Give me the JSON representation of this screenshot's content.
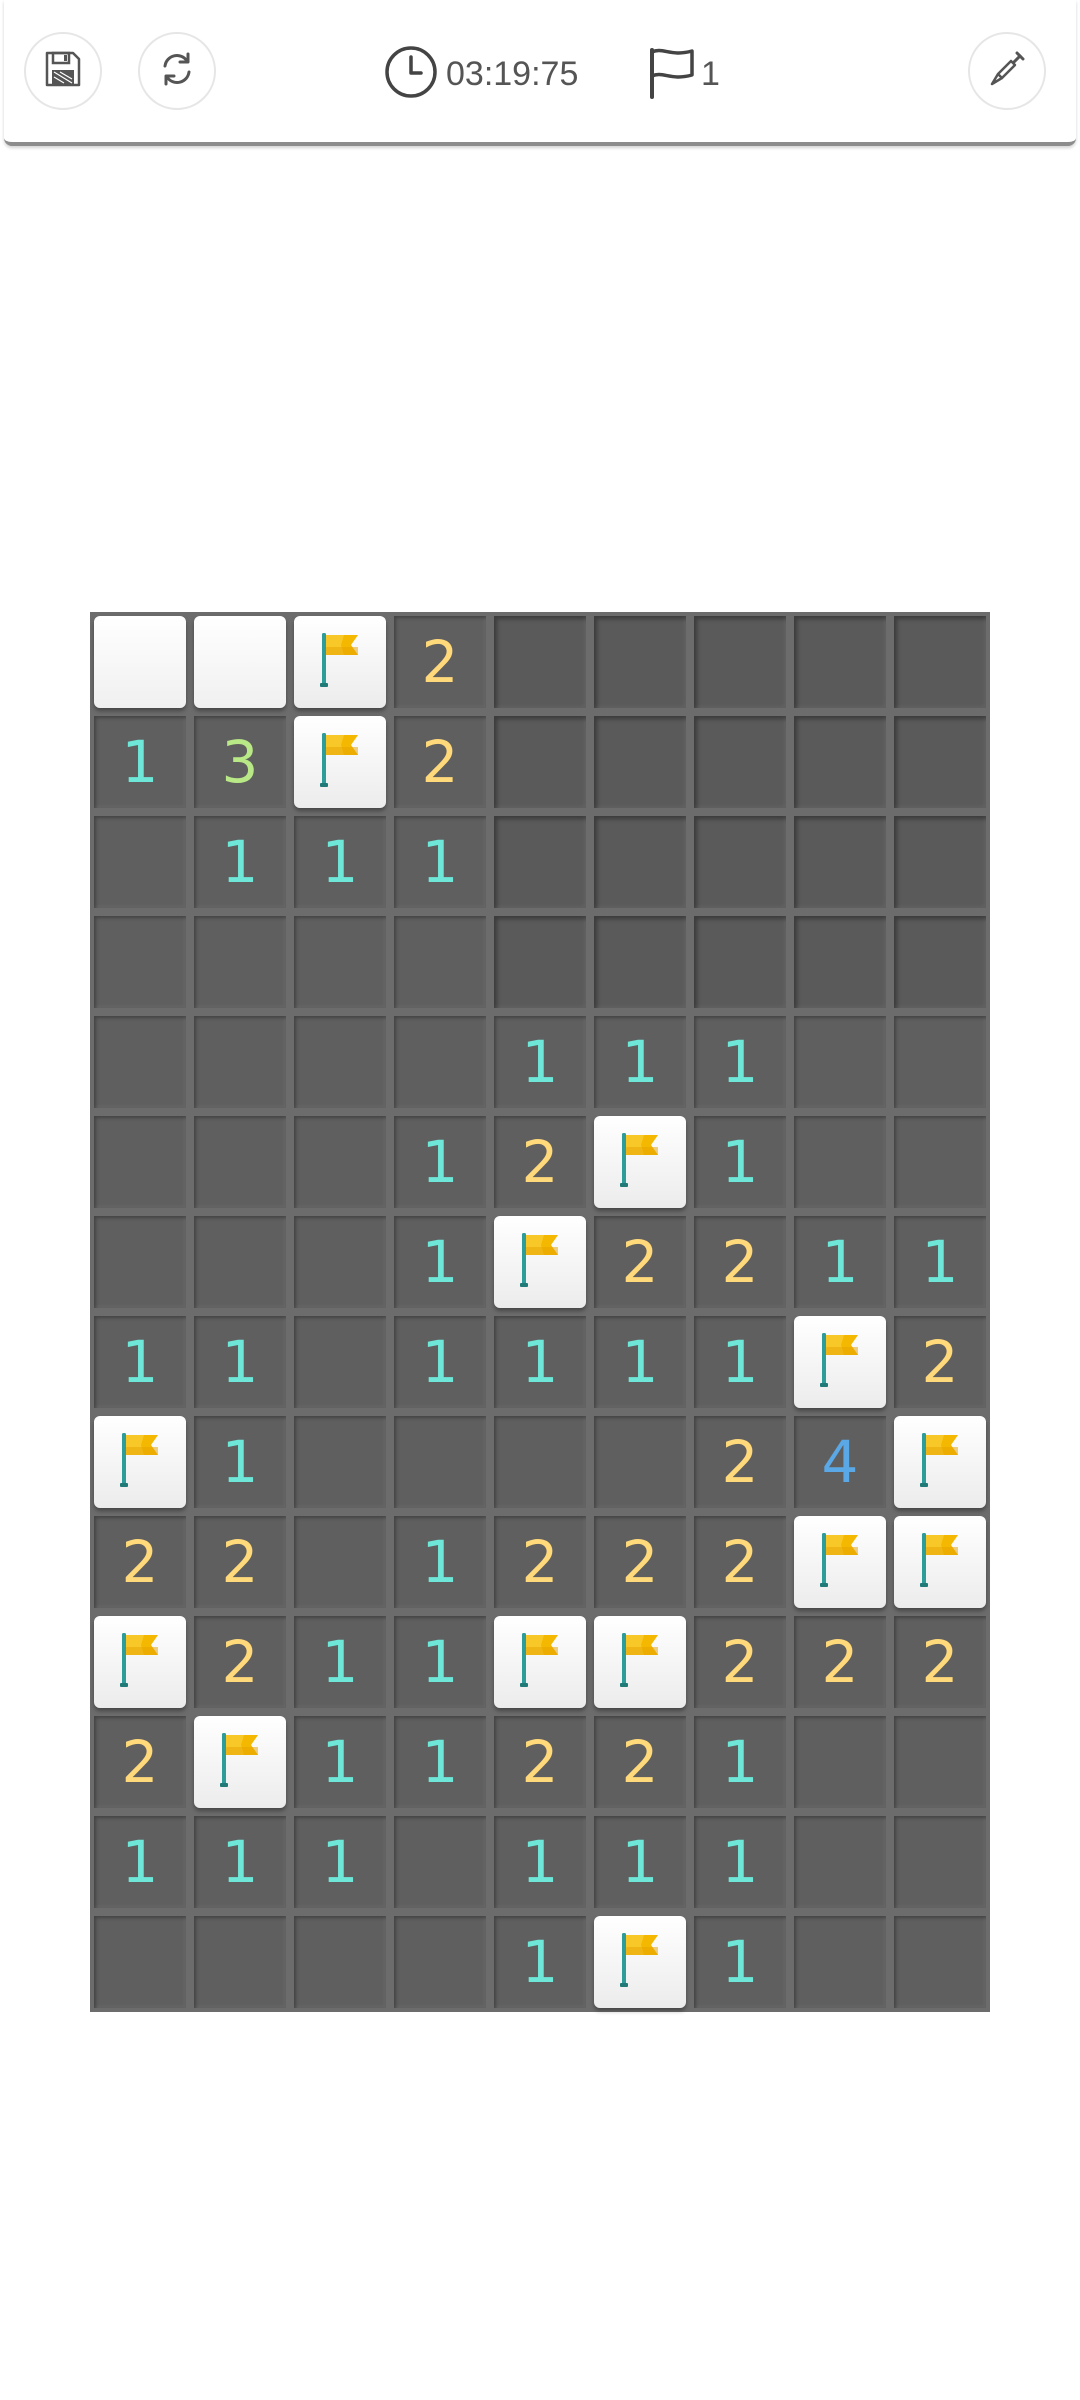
{
  "toolbar": {
    "save_icon": "floppy-disk-icon",
    "restart_icon": "refresh-icon",
    "timer_icon": "clock-icon",
    "timer": "03:19:75",
    "flag_icon": "flag-outline-icon",
    "flag_count": "1",
    "dig_icon": "shovel-icon"
  },
  "colors": {
    "one": "#6ee7d8",
    "two": "#ffd97a",
    "three": "#b8e986",
    "four": "#5aa9e6",
    "hidden": "#5a5a5a",
    "grid": "#6c6c6c",
    "flag": "#f5b800"
  },
  "board": {
    "rows": [
      [
        "W",
        "W",
        "F",
        "2",
        "H",
        "H",
        "H",
        "H",
        "H"
      ],
      [
        "1",
        "3",
        "F",
        "2",
        "H",
        "H",
        "H",
        "H",
        "H"
      ],
      [
        "O",
        "1",
        "1",
        "1",
        "H",
        "H",
        "H",
        "H",
        "H"
      ],
      [
        "O",
        "O",
        "O",
        "O",
        "H",
        "H",
        "H",
        "H",
        "H"
      ],
      [
        "O",
        "O",
        "O",
        "O",
        "1",
        "1",
        "1",
        "O",
        "O"
      ],
      [
        "O",
        "O",
        "O",
        "1",
        "2",
        "F",
        "1",
        "O",
        "O"
      ],
      [
        "O",
        "O",
        "O",
        "1",
        "F",
        "2",
        "2",
        "1",
        "1"
      ],
      [
        "1",
        "1",
        "O",
        "1",
        "1",
        "1",
        "1",
        "F",
        "2"
      ],
      [
        "F",
        "1",
        "O",
        "O",
        "O",
        "O",
        "2",
        "4",
        "F"
      ],
      [
        "2",
        "2",
        "O",
        "1",
        "2",
        "2",
        "2",
        "F",
        "F"
      ],
      [
        "F",
        "2",
        "1",
        "1",
        "F",
        "F",
        "2",
        "2",
        "2"
      ],
      [
        "2",
        "F",
        "1",
        "1",
        "2",
        "2",
        "1",
        "O",
        "O"
      ],
      [
        "1",
        "1",
        "1",
        "O",
        "1",
        "1",
        "1",
        "O",
        "O"
      ],
      [
        "O",
        "O",
        "O",
        "O",
        "1",
        "F",
        "1",
        "O",
        "O"
      ]
    ]
  }
}
